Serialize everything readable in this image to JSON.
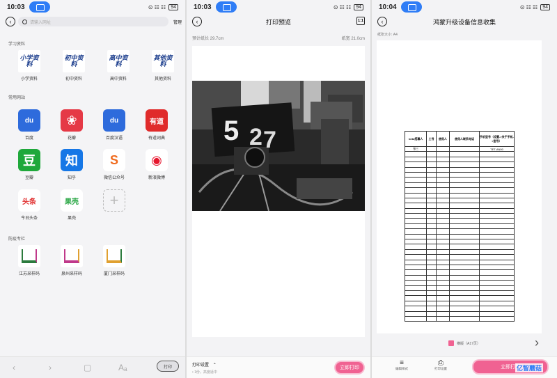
{
  "status_bars": [
    {
      "time": "10:03",
      "signal": "⊙ ☷ ☷",
      "battery": "94"
    },
    {
      "time": "10:03",
      "signal": "⊙ ☷ ☷",
      "battery": "94"
    },
    {
      "time": "10:04",
      "signal": "⊙ ☷ ☷",
      "battery": "94"
    }
  ],
  "browser": {
    "search_placeholder": "请输入网址",
    "manage_label": "管理",
    "sections": {
      "study": "学习资料",
      "sites": "常用网站",
      "epidemic": "防疫专栏"
    },
    "study_items": [
      {
        "label": "小学资料",
        "logo": "小学资料",
        "color": "#1a3c8c"
      },
      {
        "label": "初中资料",
        "logo": "初中资料",
        "color": "#1a3c8c"
      },
      {
        "label": "高中资料",
        "logo": "高中资料",
        "color": "#1a3c8c"
      },
      {
        "label": "其他资料",
        "logo": "其他资料",
        "color": "#1a3c8c"
      }
    ],
    "site_items": [
      {
        "label": "百度",
        "glyph": "du",
        "bg": "#2e6bdc",
        "fg": "#ffffff"
      },
      {
        "label": "花瓣",
        "glyph": "❀",
        "bg": "#e53946",
        "fg": "#ffffff"
      },
      {
        "label": "百度汉语",
        "glyph": "du",
        "bg": "#2e6bdc",
        "fg": "#ffffff"
      },
      {
        "label": "有道词典",
        "glyph": "有道",
        "bg": "#e02b2b",
        "fg": "#ffffff"
      },
      {
        "label": "豆瓣",
        "glyph": "豆",
        "bg": "#1fa83b",
        "fg": "#ffffff"
      },
      {
        "label": "知乎",
        "glyph": "知",
        "bg": "#1677e6",
        "fg": "#ffffff"
      },
      {
        "label": "微信公众号",
        "glyph": "S",
        "bg": "#ffffff",
        "fg": "#f06a1d"
      },
      {
        "label": "新浪微博",
        "glyph": "◉",
        "bg": "#ffffff",
        "fg": "#e6162d"
      },
      {
        "label": "今日头条",
        "glyph": "头条",
        "bg": "#ffffff",
        "fg": "#e02b2b"
      },
      {
        "label": "果壳",
        "glyph": "果壳",
        "bg": "#ffffff",
        "fg": "#2aa745"
      }
    ],
    "add_glyph": "+",
    "epidemic_items": [
      {
        "label": "江苏采样码"
      },
      {
        "label": "泉州采样码"
      },
      {
        "label": "厦门采样码"
      }
    ],
    "bottom": {
      "back": "‹",
      "forward": "›",
      "tabs": "▢",
      "font": "Aₐ",
      "print": "打印"
    }
  },
  "preview": {
    "title": "打印预览",
    "ratio_label": "1:1",
    "paper_length": "预计纸长 29.7cm",
    "paper_width": "纸宽 21.0cm",
    "photo_digits": [
      "5",
      "2",
      "7"
    ],
    "settings_label": "打印设置",
    "settings_sub": "• 1份，高度适中",
    "print_now": "立即打印"
  },
  "form": {
    "title": "鸿蒙升级设备信息收集",
    "paper_size": "纸张大小: A4",
    "headers": [
      "beta招募人",
      "工号",
      "使用人",
      "使用人联系电话",
      "手机型号（设置->关于手机->型号）"
    ],
    "first_row": [
      "张三",
      "",
      "",
      "",
      "TET-AN00"
    ],
    "empty_rows": 33,
    "checkbox_label": "横版（A17页）",
    "next_arrow": "›",
    "tool_format": "编辑样式",
    "tool_settings": "打印设置",
    "print_now": "立即打印",
    "watermark": "亿智蘑菇"
  }
}
